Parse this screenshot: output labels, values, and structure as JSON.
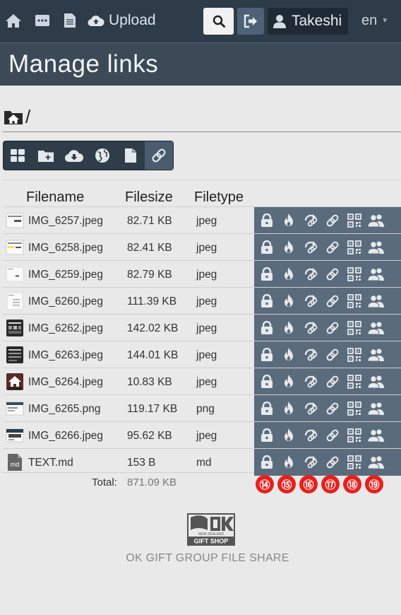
{
  "nav": {
    "icons": [
      "home-icon",
      "ellipsis-box-icon",
      "document-icon"
    ],
    "upload_label": "Upload",
    "user_name": "Takeshi",
    "language": "en"
  },
  "page": {
    "title": "Manage links"
  },
  "breadcrumb": {
    "separator": "/"
  },
  "table": {
    "headers": {
      "filename": "Filename",
      "filesize": "Filesize",
      "filetype": "Filetype"
    },
    "rows": [
      {
        "name": "IMG_6257.jpeg",
        "size": "82.71 KB",
        "type": "jpeg"
      },
      {
        "name": "IMG_6258.jpeg",
        "size": "82.41 KB",
        "type": "jpeg"
      },
      {
        "name": "IMG_6259.jpeg",
        "size": "82.79 KB",
        "type": "jpeg"
      },
      {
        "name": "IMG_6260.jpeg",
        "size": "111.39 KB",
        "type": "jpeg"
      },
      {
        "name": "IMG_6262.jpeg",
        "size": "142.02 KB",
        "type": "jpeg"
      },
      {
        "name": "IMG_6263.jpeg",
        "size": "144.01 KB",
        "type": "jpeg"
      },
      {
        "name": "IMG_6264.jpeg",
        "size": "10.83 KB",
        "type": "jpeg"
      },
      {
        "name": "IMG_6265.png",
        "size": "119.17 KB",
        "type": "png"
      },
      {
        "name": "IMG_6266.jpeg",
        "size": "95.62 KB",
        "type": "jpeg"
      },
      {
        "name": "TEXT.md",
        "size": "153 B",
        "type": "md"
      }
    ],
    "total_label": "Total:",
    "total_value": "871.09 KB"
  },
  "markers": [
    "⑭",
    "⑮",
    "⑯",
    "⑰",
    "⑱",
    "⑲"
  ],
  "md_thumb_label": "md",
  "logo_text": {
    "main": "OK",
    "small": "NEW ZEALAND",
    "band": "GIFT SHOP"
  },
  "footer": {
    "text": "OK GIFT GROUP FILE SHARE"
  },
  "colors": {
    "topbar": "#2e3b48",
    "title_band": "#3c4a58",
    "actions_bg": "#5a6b7c",
    "marker": "#e8201c"
  }
}
